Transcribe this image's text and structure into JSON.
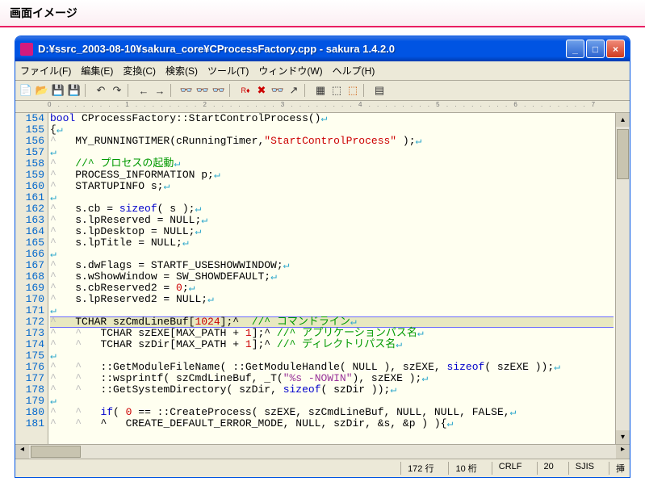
{
  "page_heading": "画面イメージ",
  "window": {
    "title": "D:¥ssrc_2003-08-10¥sakura_core¥CProcessFactory.cpp - sakura 1.4.2.0"
  },
  "menus": {
    "file": "ファイル(F)",
    "edit": "編集(E)",
    "convert": "変換(C)",
    "search": "検索(S)",
    "tool": "ツール(T)",
    "window": "ウィンドウ(W)",
    "help": "ヘルプ(H)"
  },
  "status": {
    "line": "172 行",
    "col": "10 桁",
    "eol": "CRLF",
    "enc_num": "20",
    "enc": "SJIS",
    "mode": "挿"
  },
  "gutter_start": 154,
  "gutter_end": 181,
  "code_lines": [
    {
      "indent": 0,
      "tokens": [
        {
          "t": "bool",
          "c": "k-blue"
        },
        {
          "t": " CProcessFactory::StartControlProcess()"
        }
      ],
      "eol": true
    },
    {
      "indent": 0,
      "tokens": [
        {
          "t": "{"
        }
      ],
      "eol": true
    },
    {
      "indent": 1,
      "tokens": [
        {
          "t": "MY_RUNNINGTIMER(cRunningTimer,"
        },
        {
          "t": "\"StartControlProcess\"",
          "c": "k-red"
        },
        {
          "t": " );"
        }
      ],
      "eol": true
    },
    {
      "indent": 0,
      "tokens": [],
      "eol": true
    },
    {
      "indent": 1,
      "tokens": [
        {
          "t": "//^ プロセスの起動",
          "c": "k-green"
        }
      ],
      "eol": true
    },
    {
      "indent": 1,
      "tokens": [
        {
          "t": "PROCESS_INFORMATION p;"
        }
      ],
      "eol": true
    },
    {
      "indent": 1,
      "tokens": [
        {
          "t": "STARTUPINFO s;"
        }
      ],
      "eol": true
    },
    {
      "indent": 0,
      "tokens": [],
      "eol": true
    },
    {
      "indent": 1,
      "tokens": [
        {
          "t": "s.cb = "
        },
        {
          "t": "sizeof",
          "c": "k-blue"
        },
        {
          "t": "( s );"
        }
      ],
      "eol": true
    },
    {
      "indent": 1,
      "tokens": [
        {
          "t": "s.lpReserved = NULL;"
        }
      ],
      "eol": true
    },
    {
      "indent": 1,
      "tokens": [
        {
          "t": "s.lpDesktop = NULL;"
        }
      ],
      "eol": true
    },
    {
      "indent": 1,
      "tokens": [
        {
          "t": "s.lpTitle = NULL;"
        }
      ],
      "eol": true
    },
    {
      "indent": 0,
      "tokens": [],
      "eol": true
    },
    {
      "indent": 1,
      "tokens": [
        {
          "t": "s.dwFlags = STARTF_USESHOWWINDOW;"
        }
      ],
      "eol": true
    },
    {
      "indent": 1,
      "tokens": [
        {
          "t": "s.wShowWindow = SW_SHOWDEFAULT;"
        }
      ],
      "eol": true
    },
    {
      "indent": 1,
      "tokens": [
        {
          "t": "s.cbReserved2 = "
        },
        {
          "t": "0",
          "c": "k-num"
        },
        {
          "t": ";"
        }
      ],
      "eol": true
    },
    {
      "indent": 1,
      "tokens": [
        {
          "t": "s.lpReserved2 = NULL;"
        }
      ],
      "eol": true
    },
    {
      "indent": 0,
      "tokens": [],
      "eol": true
    },
    {
      "indent": 1,
      "hl": true,
      "tokens": [
        {
          "t": "TCHAR szCmdLineBuf["
        },
        {
          "t": "1024",
          "c": "k-num"
        },
        {
          "t": "];^  "
        },
        {
          "t": "//^ コマンドライン",
          "c": "k-green"
        }
      ],
      "eol": true
    },
    {
      "indent": 2,
      "tokens": [
        {
          "t": "TCHAR szEXE[MAX_PATH + "
        },
        {
          "t": "1",
          "c": "k-num"
        },
        {
          "t": "];^ "
        },
        {
          "t": "//^ アプリケーションパス名",
          "c": "k-green"
        }
      ],
      "eol": true
    },
    {
      "indent": 2,
      "tokens": [
        {
          "t": "TCHAR szDir[MAX_PATH + "
        },
        {
          "t": "1",
          "c": "k-num"
        },
        {
          "t": "];^ "
        },
        {
          "t": "//^ ディレクトリパス名",
          "c": "k-green"
        }
      ],
      "eol": true
    },
    {
      "indent": 0,
      "tokens": [],
      "eol": true
    },
    {
      "indent": 2,
      "tokens": [
        {
          "t": "::GetModuleFileName( ::GetModuleHandle( NULL ), szEXE, "
        },
        {
          "t": "sizeof",
          "c": "k-blue"
        },
        {
          "t": "( szEXE ));"
        }
      ],
      "eol": true
    },
    {
      "indent": 2,
      "tokens": [
        {
          "t": "::wsprintf( szCmdLineBuf, _T("
        },
        {
          "t": "\"%s -NOWIN\"",
          "c": "k-str"
        },
        {
          "t": "), szEXE );"
        }
      ],
      "eol": true
    },
    {
      "indent": 2,
      "tokens": [
        {
          "t": "::GetSystemDirectory( szDir, "
        },
        {
          "t": "sizeof",
          "c": "k-blue"
        },
        {
          "t": "( szDir ));"
        }
      ],
      "eol": true
    },
    {
      "indent": 0,
      "tokens": [],
      "eol": true
    },
    {
      "indent": 2,
      "tokens": [
        {
          "t": "if",
          "c": "k-blue"
        },
        {
          "t": "( "
        },
        {
          "t": "0",
          "c": "k-num"
        },
        {
          "t": " == ::CreateProcess( szEXE, szCmdLineBuf, NULL, NULL, FALSE,"
        }
      ],
      "eol": true
    },
    {
      "indent": 2,
      "tokens": [
        {
          "t": "^   CREATE_DEFAULT_ERROR_MODE, NULL, szDir, &s, &p ) ){"
        }
      ],
      "eol": true
    }
  ]
}
